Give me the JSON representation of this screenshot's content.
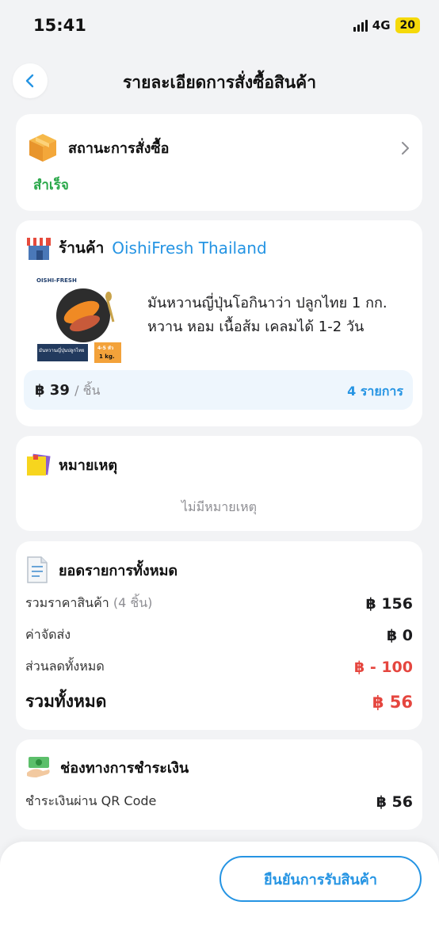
{
  "status_bar": {
    "time": "15:41",
    "network": "4G",
    "battery": "20"
  },
  "header": {
    "title": "รายละเอียดการสั่งซื้อสินค้า"
  },
  "order_status": {
    "title": "สถานะการสั่งซื้อ",
    "value": "สำเร็จ"
  },
  "store": {
    "label": "ร้านค้า",
    "name": "OishiFresh Thailand",
    "product_title": "มันหวานญี่ปุ่นโอกินาว่า ปลูกไทย 1 กก. หวาน หอม เนื้อส้ม เคลมได้ 1-2 วัน",
    "image_text": {
      "brand": "OISHI-FRESH",
      "caption": "มันหวานญี่ปุ่นปลูกไทย",
      "badge": "4-5 หัว",
      "weight": "1 kg."
    },
    "price": "฿ 39",
    "price_unit": "/ ชิ้น",
    "items_count": "4 รายการ"
  },
  "note": {
    "title": "หมายเหตุ",
    "empty_text": "ไม่มีหมายเหตุ"
  },
  "summary": {
    "title": "ยอดรายการทั้งหมด",
    "subtotal_label": "รวมราคาสินค้า",
    "subtotal_qty": "(4 ชิ้น)",
    "subtotal_value": "฿ 156",
    "shipping_label": "ค่าจัดส่ง",
    "shipping_value": "฿ 0",
    "discount_label": "ส่วนลดทั้งหมด",
    "discount_value": "฿ - 100",
    "total_label": "รวมทั้งหมด",
    "total_value": "฿ 56"
  },
  "payment": {
    "title": "ช่องทางการชำระเงิน",
    "method": "ชำระเงินผ่าน QR Code",
    "amount": "฿ 56"
  },
  "footer": {
    "confirm_label": "ยืนยันการรับสินค้า"
  },
  "colors": {
    "accent": "#2594e3",
    "success": "#2aa84a",
    "danger": "#e5463f"
  }
}
